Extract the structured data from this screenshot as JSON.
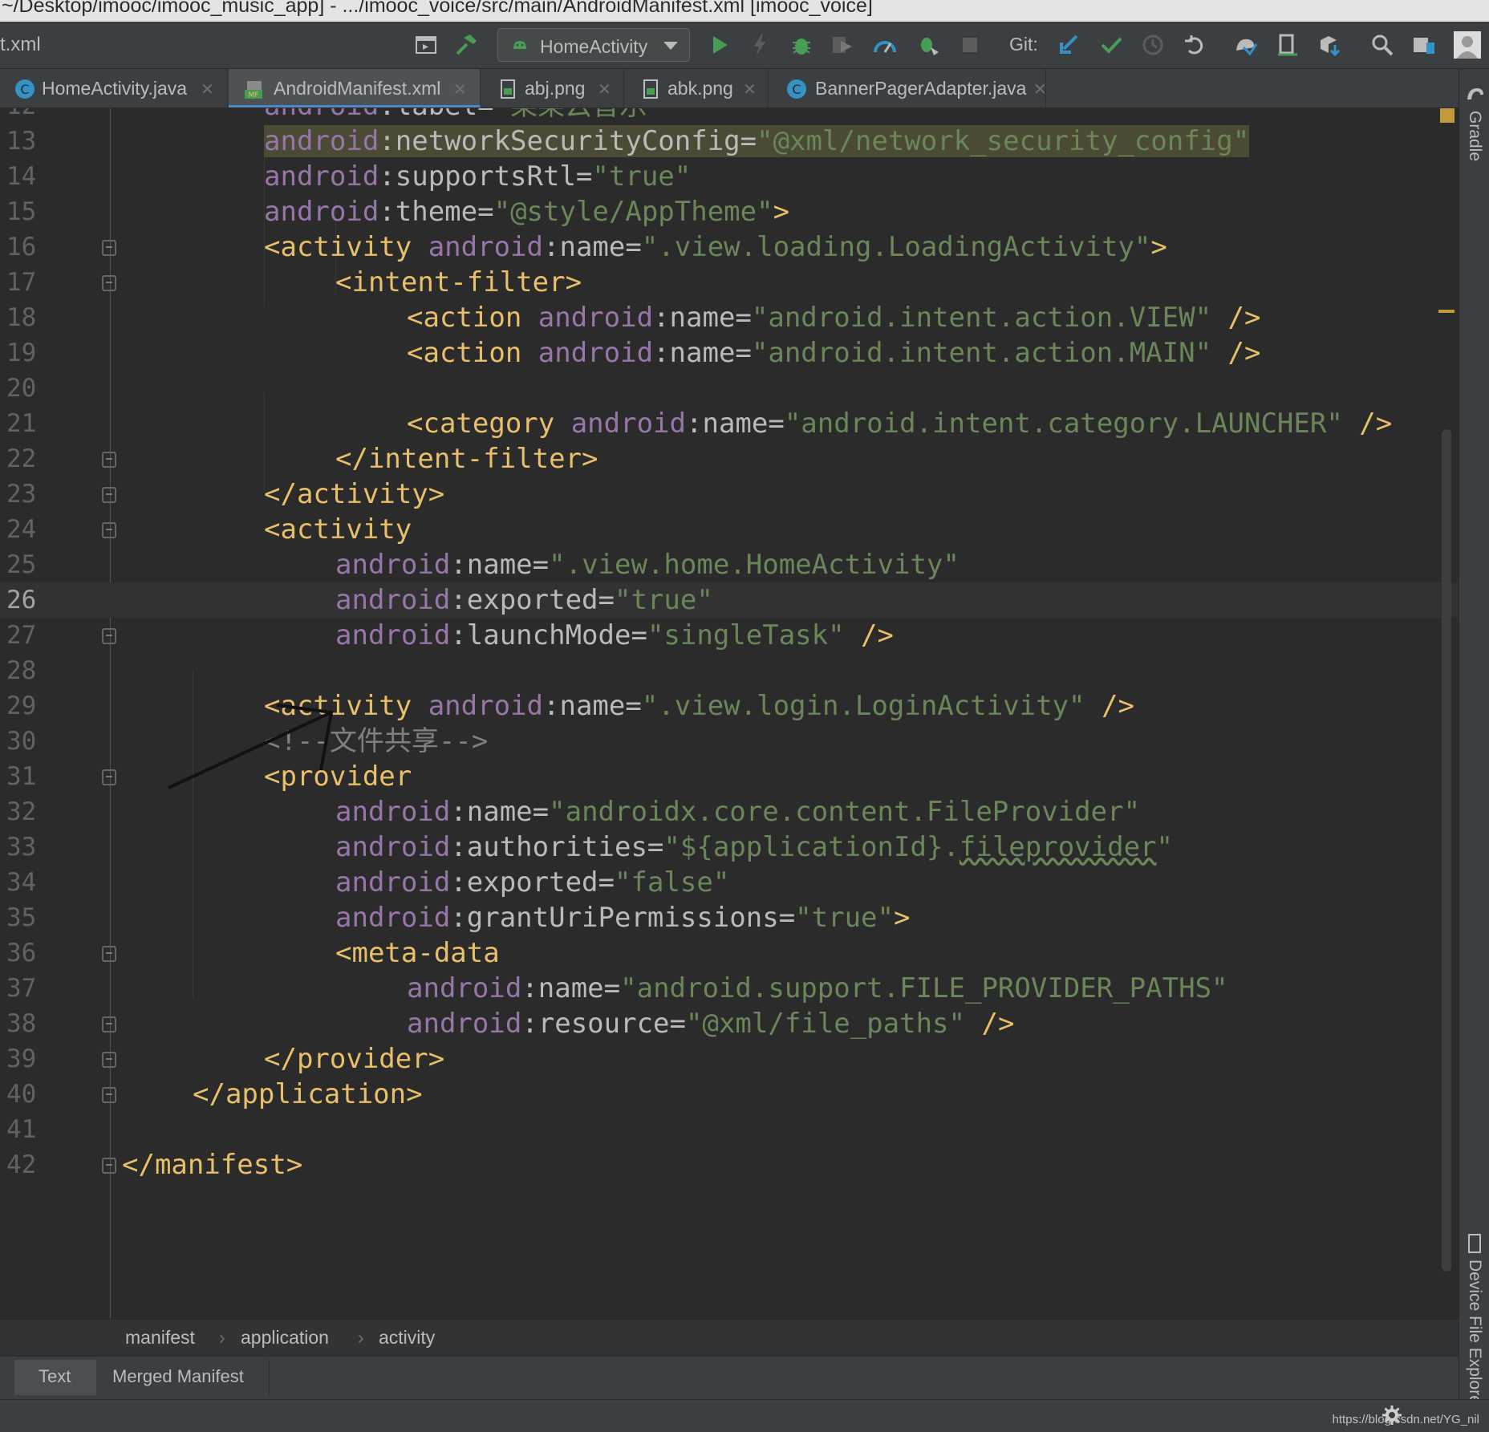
{
  "window": {
    "title": "~/Desktop/imooc/imooc_music_app] - .../imooc_voice/src/main/AndroidManifest.xml [imooc_voice]"
  },
  "toolbar": {
    "file_label": "t.xml",
    "run_config": "HomeActivity",
    "git_label": "Git:",
    "icons": [
      "project-structure-icon",
      "build-hammer-icon",
      "run-icon",
      "apply-changes-icon",
      "debug-bug-icon",
      "coverage-icon",
      "profile-icon",
      "attach-debugger-icon",
      "stop-icon",
      "git-update-icon",
      "git-commit-icon",
      "git-history-icon",
      "git-revert-icon",
      "sync-gradle-icon",
      "avd-manager-icon",
      "sdk-manager-icon",
      "search-icon",
      "project-view-icon",
      "user-avatar-icon"
    ]
  },
  "tabs": [
    {
      "label": "HomeActivity.java",
      "icon": "java-class-icon",
      "active": false
    },
    {
      "label": "AndroidManifest.xml",
      "icon": "manifest-file-icon",
      "active": true
    },
    {
      "label": "abj.png",
      "icon": "image-file-icon",
      "active": false
    },
    {
      "label": "abk.png",
      "icon": "image-file-icon",
      "active": false
    },
    {
      "label": "BannerPagerAdapter.java",
      "icon": "java-class-icon",
      "active": false
    }
  ],
  "side_panels": {
    "gradle": "Gradle",
    "device_explorer": "Device File Explorer"
  },
  "editor": {
    "current_line": "26",
    "lines": [
      {
        "n": "12",
        "segs": [
          [
            "ns",
            "android"
          ],
          [
            "an",
            ":label="
          ],
          [
            "v",
            "\"某某云音乐\""
          ]
        ]
      },
      {
        "n": "13",
        "segs": [
          [
            "ns",
            "android"
          ],
          [
            "an",
            ":networkSecurityConfig="
          ],
          [
            "v",
            "\"@xml/network_security_config\""
          ]
        ]
      },
      {
        "n": "14",
        "segs": [
          [
            "ns",
            "android"
          ],
          [
            "an",
            ":supportsRtl="
          ],
          [
            "v",
            "\"true\""
          ]
        ]
      },
      {
        "n": "15",
        "segs": [
          [
            "ns",
            "android"
          ],
          [
            "an",
            ":theme="
          ],
          [
            "v",
            "\"@style/AppTheme\""
          ],
          [
            "t",
            ">"
          ]
        ]
      },
      {
        "n": "16",
        "segs": [
          [
            "t",
            "<activity "
          ],
          [
            "ns",
            "android"
          ],
          [
            "an",
            ":name="
          ],
          [
            "v",
            "\".view.loading.LoadingActivity\""
          ],
          [
            "t",
            ">"
          ]
        ]
      },
      {
        "n": "17",
        "segs": [
          [
            "t",
            "<intent-filter>"
          ]
        ]
      },
      {
        "n": "18",
        "segs": [
          [
            "t",
            "<action "
          ],
          [
            "ns",
            "android"
          ],
          [
            "an",
            ":name="
          ],
          [
            "v",
            "\"android.intent.action.VIEW\""
          ],
          [
            "t",
            " />"
          ]
        ]
      },
      {
        "n": "19",
        "segs": [
          [
            "t",
            "<action "
          ],
          [
            "ns",
            "android"
          ],
          [
            "an",
            ":name="
          ],
          [
            "v",
            "\"android.intent.action.MAIN\""
          ],
          [
            "t",
            " />"
          ]
        ]
      },
      {
        "n": "20",
        "segs": []
      },
      {
        "n": "21",
        "segs": [
          [
            "t",
            "<category "
          ],
          [
            "ns",
            "android"
          ],
          [
            "an",
            ":name="
          ],
          [
            "v",
            "\"android.intent.category.LAUNCHER\""
          ],
          [
            "t",
            " />"
          ]
        ]
      },
      {
        "n": "22",
        "segs": [
          [
            "t",
            "</intent-filter>"
          ]
        ]
      },
      {
        "n": "23",
        "segs": [
          [
            "t",
            "</activity>"
          ]
        ]
      },
      {
        "n": "24",
        "segs": [
          [
            "t",
            "<activity"
          ]
        ]
      },
      {
        "n": "25",
        "segs": [
          [
            "ns",
            "android"
          ],
          [
            "an",
            ":name="
          ],
          [
            "v",
            "\".view.home.HomeActivity\""
          ]
        ]
      },
      {
        "n": "26",
        "segs": [
          [
            "ns",
            "android"
          ],
          [
            "an",
            ":exported="
          ],
          [
            "v",
            "\"true\""
          ]
        ]
      },
      {
        "n": "27",
        "segs": [
          [
            "ns",
            "android"
          ],
          [
            "an",
            ":launchMode="
          ],
          [
            "v",
            "\"singleTask\""
          ],
          [
            "t",
            " />"
          ]
        ]
      },
      {
        "n": "28",
        "segs": []
      },
      {
        "n": "29",
        "segs": [
          [
            "t",
            "<activity "
          ],
          [
            "ns",
            "android"
          ],
          [
            "an",
            ":name="
          ],
          [
            "v",
            "\".view.login.LoginActivity\""
          ],
          [
            "t",
            " />"
          ]
        ]
      },
      {
        "n": "30",
        "segs": [
          [
            "cm",
            "<!--文件共享-->"
          ]
        ]
      },
      {
        "n": "31",
        "segs": [
          [
            "t",
            "<provider"
          ]
        ]
      },
      {
        "n": "32",
        "segs": [
          [
            "ns",
            "android"
          ],
          [
            "an",
            ":name="
          ],
          [
            "v",
            "\"androidx.core.content.FileProvider\""
          ]
        ]
      },
      {
        "n": "33",
        "segs": [
          [
            "ns",
            "android"
          ],
          [
            "an",
            ":authorities="
          ],
          [
            "v",
            "\"${applicationId}."
          ],
          [
            "vsq",
            "fileprovider"
          ],
          [
            "v",
            "\""
          ]
        ]
      },
      {
        "n": "34",
        "segs": [
          [
            "ns",
            "android"
          ],
          [
            "an",
            ":exported="
          ],
          [
            "v",
            "\"false\""
          ]
        ]
      },
      {
        "n": "35",
        "segs": [
          [
            "ns",
            "android"
          ],
          [
            "an",
            ":grantUriPermissions="
          ],
          [
            "v",
            "\"true\""
          ],
          [
            "t",
            ">"
          ]
        ]
      },
      {
        "n": "36",
        "segs": [
          [
            "t",
            "<meta-data"
          ]
        ]
      },
      {
        "n": "37",
        "segs": [
          [
            "ns",
            "android"
          ],
          [
            "an",
            ":name="
          ],
          [
            "v",
            "\"android.support.FILE_PROVIDER_PATHS\""
          ]
        ]
      },
      {
        "n": "38",
        "segs": [
          [
            "ns",
            "android"
          ],
          [
            "an",
            ":resource="
          ],
          [
            "v",
            "\"@xml/file_paths\""
          ],
          [
            "t",
            " />"
          ]
        ]
      },
      {
        "n": "39",
        "segs": [
          [
            "t",
            "</provider>"
          ]
        ]
      },
      {
        "n": "40",
        "segs": [
          [
            "t",
            "</application>"
          ]
        ]
      },
      {
        "n": "41",
        "segs": []
      },
      {
        "n": "42",
        "segs": [
          [
            "t",
            "</manifest>"
          ]
        ]
      }
    ]
  },
  "breadcrumb": [
    "manifest",
    "application",
    "activity"
  ],
  "bottom_tabs": [
    {
      "label": "Text",
      "active": true
    },
    {
      "label": "Merged Manifest",
      "active": false
    }
  ],
  "status": {
    "watermark": "https://blog.csdn.net/YG_nil"
  },
  "colors": {
    "editor_bg": "#2b2b2b",
    "tag": "#e8bf6a",
    "namespace": "#9876aa",
    "attr": "#bababa",
    "value": "#6a8759",
    "comment": "#808080",
    "run_green": "#499c54",
    "git_blue": "#3592c4"
  }
}
